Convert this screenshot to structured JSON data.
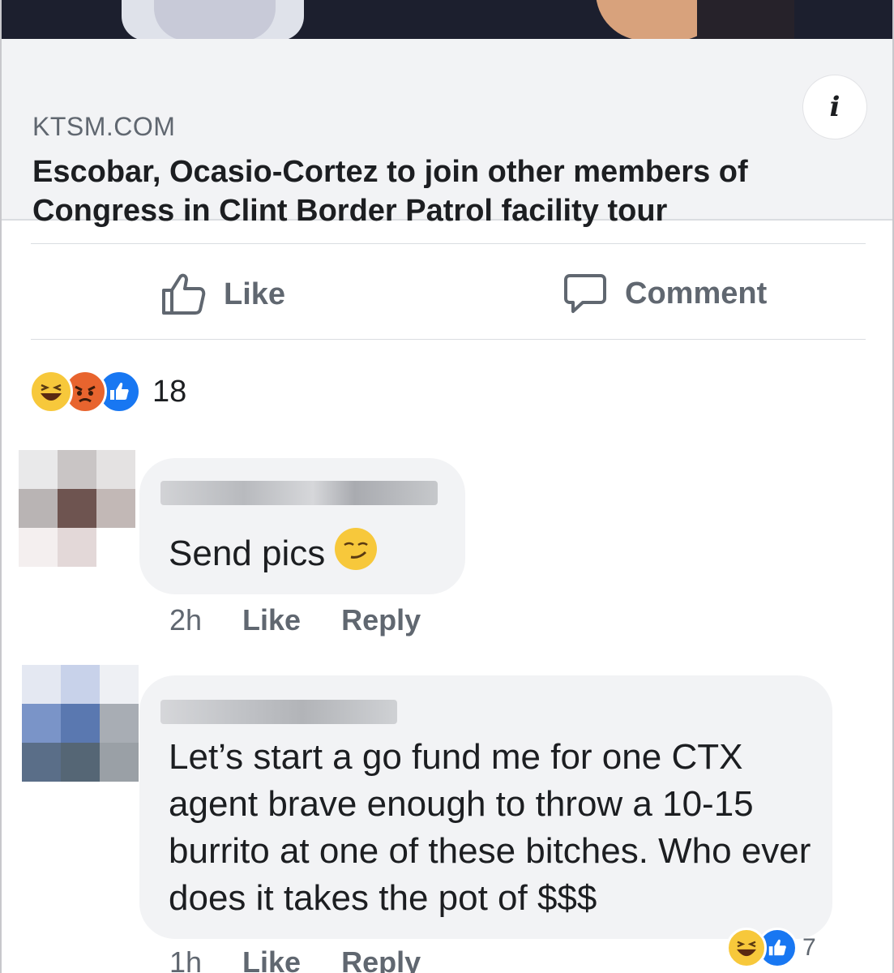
{
  "link_preview": {
    "domain": "KTSM.COM",
    "headline": "Escobar, Ocasio-Cortez to join other members of Congress in Clint Border Patrol facility tour",
    "info_icon": "info-icon",
    "info_glyph": "i"
  },
  "actions": {
    "like_label": "Like",
    "comment_label": "Comment"
  },
  "reactions": {
    "types": [
      "haha",
      "angry",
      "like"
    ],
    "count": "18"
  },
  "comments": [
    {
      "text": "Send pics",
      "emoji": "smirking-face",
      "time": "2h",
      "like_label": "Like",
      "reply_label": "Reply"
    },
    {
      "text": "Let’s start a go fund me for one CTX agent brave enough to throw a 10-15 burrito at one of these bitches. Who ever does it takes the pot of $$$",
      "time": "1h",
      "like_label": "Like",
      "reply_label": "Reply",
      "reactions": [
        "haha",
        "like"
      ],
      "reaction_count": "7"
    }
  ],
  "colors": {
    "background": "#ffffff",
    "bubble": "#f2f3f5",
    "secondary_text": "#606770",
    "primary_text": "#1c1e21",
    "like_blue": "#1877f2",
    "haha_yellow": "#f7c83b",
    "angry_orange": "#e8642e"
  }
}
